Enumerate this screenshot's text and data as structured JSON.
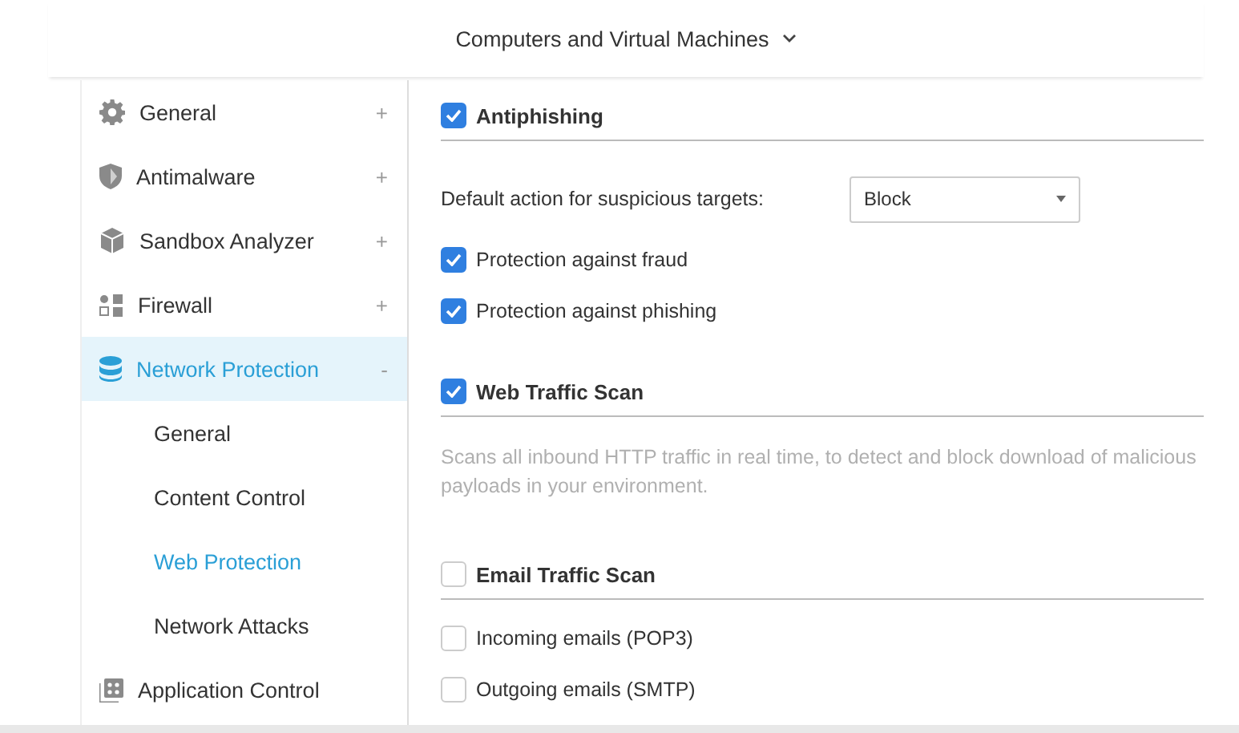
{
  "header": {
    "title": "Computers and Virtual Machines"
  },
  "sidebar": {
    "items": [
      {
        "label": "General",
        "kind": "gear",
        "expander": "+",
        "selected": false
      },
      {
        "label": "Antimalware",
        "kind": "shield",
        "expander": "+",
        "selected": false
      },
      {
        "label": "Sandbox Analyzer",
        "kind": "cube",
        "expander": "+",
        "selected": false
      },
      {
        "label": "Firewall",
        "kind": "blocks",
        "expander": "+",
        "selected": false
      },
      {
        "label": "Network Protection",
        "kind": "database",
        "expander": "-",
        "selected": true,
        "children": [
          {
            "label": "General",
            "selected": false
          },
          {
            "label": "Content Control",
            "selected": false
          },
          {
            "label": "Web Protection",
            "selected": true
          },
          {
            "label": "Network Attacks",
            "selected": false
          }
        ]
      },
      {
        "label": "Application Control",
        "kind": "apps",
        "selected": false
      }
    ]
  },
  "sections": [
    {
      "title": "Antiphishing",
      "checked": true,
      "items": [
        {
          "kind": "select",
          "label": "Default action for suspicious targets:",
          "value": "Block"
        },
        {
          "kind": "checkbox",
          "label": "Protection against fraud",
          "checked": true
        },
        {
          "kind": "checkbox",
          "label": "Protection against phishing",
          "checked": true
        }
      ]
    },
    {
      "title": "Web Traffic Scan",
      "checked": true,
      "items": [
        {
          "kind": "text",
          "text": "Scans all inbound HTTP traffic in real time, to detect and block download of malicious payloads in your environment."
        }
      ]
    },
    {
      "title": "Email Traffic Scan",
      "checked": false,
      "items": [
        {
          "kind": "checkbox",
          "label": "Incoming emails (POP3)",
          "checked": false
        },
        {
          "kind": "checkbox",
          "label": "Outgoing emails (SMTP)",
          "checked": false
        }
      ]
    }
  ]
}
